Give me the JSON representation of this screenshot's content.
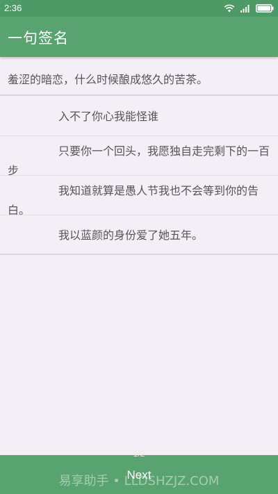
{
  "status_bar": {
    "time": "2:36",
    "icons": [
      "wifi-icon",
      "signal-icon",
      "battery-icon"
    ]
  },
  "app_bar": {
    "title": "一句签名"
  },
  "header": {
    "quote": "羞涩的暗恋，什么时候酿成悠久的苦茶。"
  },
  "items": [
    {
      "text": "入不了你心我能怪谁"
    },
    {
      "text": "只要你一个回头，我愿独自走完剩下的一百步"
    },
    {
      "text": "我知道就算是愚人节我也不会等到你的告白。"
    },
    {
      "text": "我以蓝颜的身份爱了她五年。"
    }
  ],
  "pager": {
    "page_indicator": "1/2",
    "next_label": "Next"
  },
  "watermark": "易享助手 • LLDSHZJZ.COM",
  "colors": {
    "status_bar": "#4e9a66",
    "app_bar": "#58a36f",
    "background": "#f4eef7",
    "text": "#555555"
  }
}
